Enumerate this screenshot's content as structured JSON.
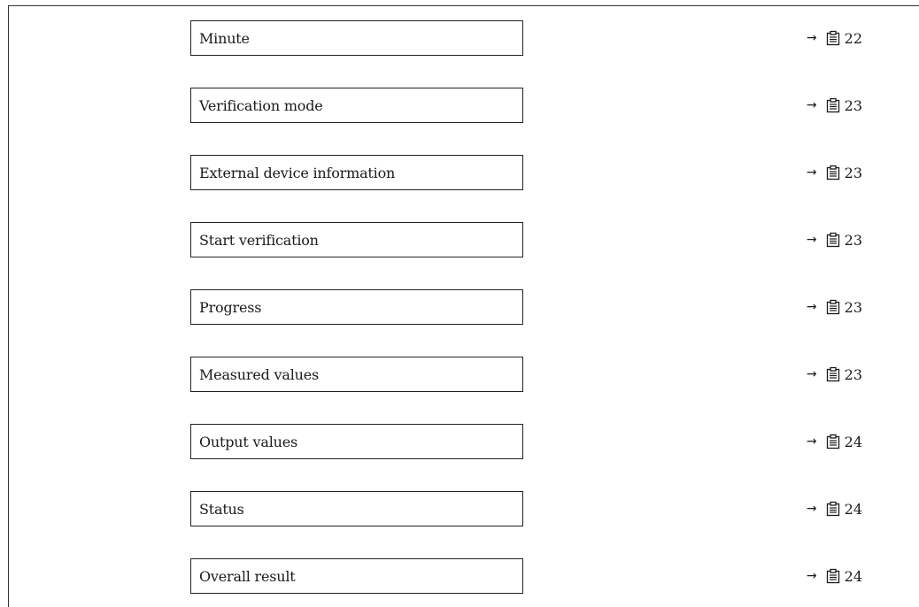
{
  "rows": [
    {
      "label": "Minute",
      "arrow": "→",
      "page": "22"
    },
    {
      "label": "Verification mode",
      "arrow": "→",
      "page": "23"
    },
    {
      "label": "External device information",
      "arrow": "→",
      "page": "23"
    },
    {
      "label": "Start verification",
      "arrow": "→",
      "page": "23"
    },
    {
      "label": "Progress",
      "arrow": "→",
      "page": "23"
    },
    {
      "label": "Measured values",
      "arrow": "→",
      "page": "23"
    },
    {
      "label": "Output values",
      "arrow": "→",
      "page": "24"
    },
    {
      "label": "Status",
      "arrow": "→",
      "page": "24"
    },
    {
      "label": "Overall result",
      "arrow": "→",
      "page": "24"
    }
  ],
  "icons": {
    "page_reference": "page-reference-icon"
  },
  "colors": {
    "text": "#1a1a1a",
    "border": "#222222",
    "background": "#ffffff"
  }
}
